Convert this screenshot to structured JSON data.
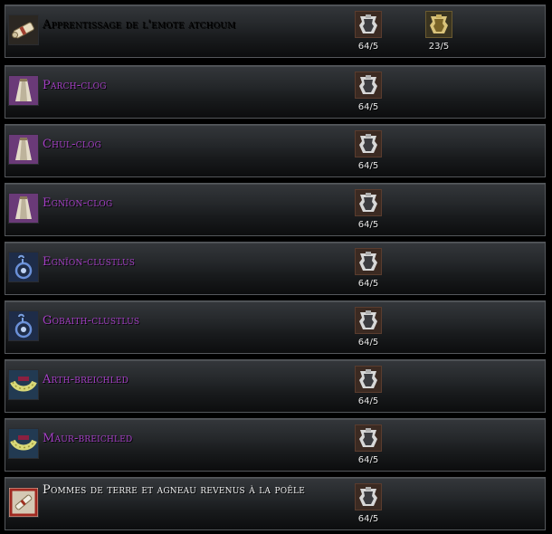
{
  "recipes": [
    {
      "name": "Apprentissage de l'emote atchoum",
      "color": "white",
      "icon": "scroll-icon",
      "costs": [
        {
          "icon": "dark-armour-token-icon",
          "qty": "64/5"
        },
        {
          "icon": "gold-armour-token-icon",
          "qty": "23/5"
        }
      ]
    },
    {
      "name": "Parch-clog",
      "color": "purple",
      "icon": "cloak-icon",
      "costs": [
        {
          "icon": "dark-armour-token-icon",
          "qty": "64/5"
        }
      ]
    },
    {
      "name": "Chul-clog",
      "color": "purple",
      "icon": "cloak-icon",
      "costs": [
        {
          "icon": "dark-armour-token-icon",
          "qty": "64/5"
        }
      ]
    },
    {
      "name": "Egnïon-clog",
      "color": "purple",
      "icon": "cloak-icon",
      "costs": [
        {
          "icon": "dark-armour-token-icon",
          "qty": "64/5"
        }
      ]
    },
    {
      "name": "Egnïon-clustlus",
      "color": "purple",
      "icon": "earring-icon",
      "costs": [
        {
          "icon": "dark-armour-token-icon",
          "qty": "64/5"
        }
      ]
    },
    {
      "name": "Gobaith-clustlus",
      "color": "purple",
      "icon": "earring-icon",
      "costs": [
        {
          "icon": "dark-armour-token-icon",
          "qty": "64/5"
        }
      ]
    },
    {
      "name": "Arth-breichled",
      "color": "purple",
      "icon": "bracelet-icon",
      "costs": [
        {
          "icon": "dark-armour-token-icon",
          "qty": "64/5"
        }
      ]
    },
    {
      "name": "Maur-breichled",
      "color": "purple",
      "icon": "bracelet-icon",
      "costs": [
        {
          "icon": "dark-armour-token-icon",
          "qty": "64/5"
        }
      ]
    },
    {
      "name": "Pommes de terre et agneau revenus à la poêle",
      "color": "white",
      "icon": "recipe-scroll-icon",
      "costs": [
        {
          "icon": "dark-armour-token-icon",
          "qty": "64/5"
        }
      ]
    }
  ]
}
